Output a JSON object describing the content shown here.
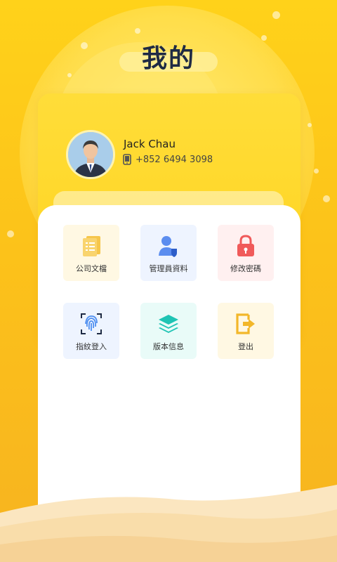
{
  "page": {
    "title": "我的"
  },
  "profile": {
    "name": "Jack Chau",
    "phone": "+852 6494 3098"
  },
  "menu": {
    "items": [
      {
        "label": "公司文檔",
        "icon": "document-icon",
        "bg": "#fff8e3"
      },
      {
        "label": "管理員資料",
        "icon": "admin-user-icon",
        "bg": "#eef4ff"
      },
      {
        "label": "修改密碼",
        "icon": "lock-icon",
        "bg": "#fff0f0"
      },
      {
        "label": "指紋登入",
        "icon": "fingerprint-icon",
        "bg": "#eef4ff"
      },
      {
        "label": "版本信息",
        "icon": "layers-icon",
        "bg": "#e9fbf8"
      },
      {
        "label": "登出",
        "icon": "logout-icon",
        "bg": "#fff8e3"
      }
    ]
  },
  "colors": {
    "accent": "#ffd21a",
    "title": "#1f2a44"
  }
}
